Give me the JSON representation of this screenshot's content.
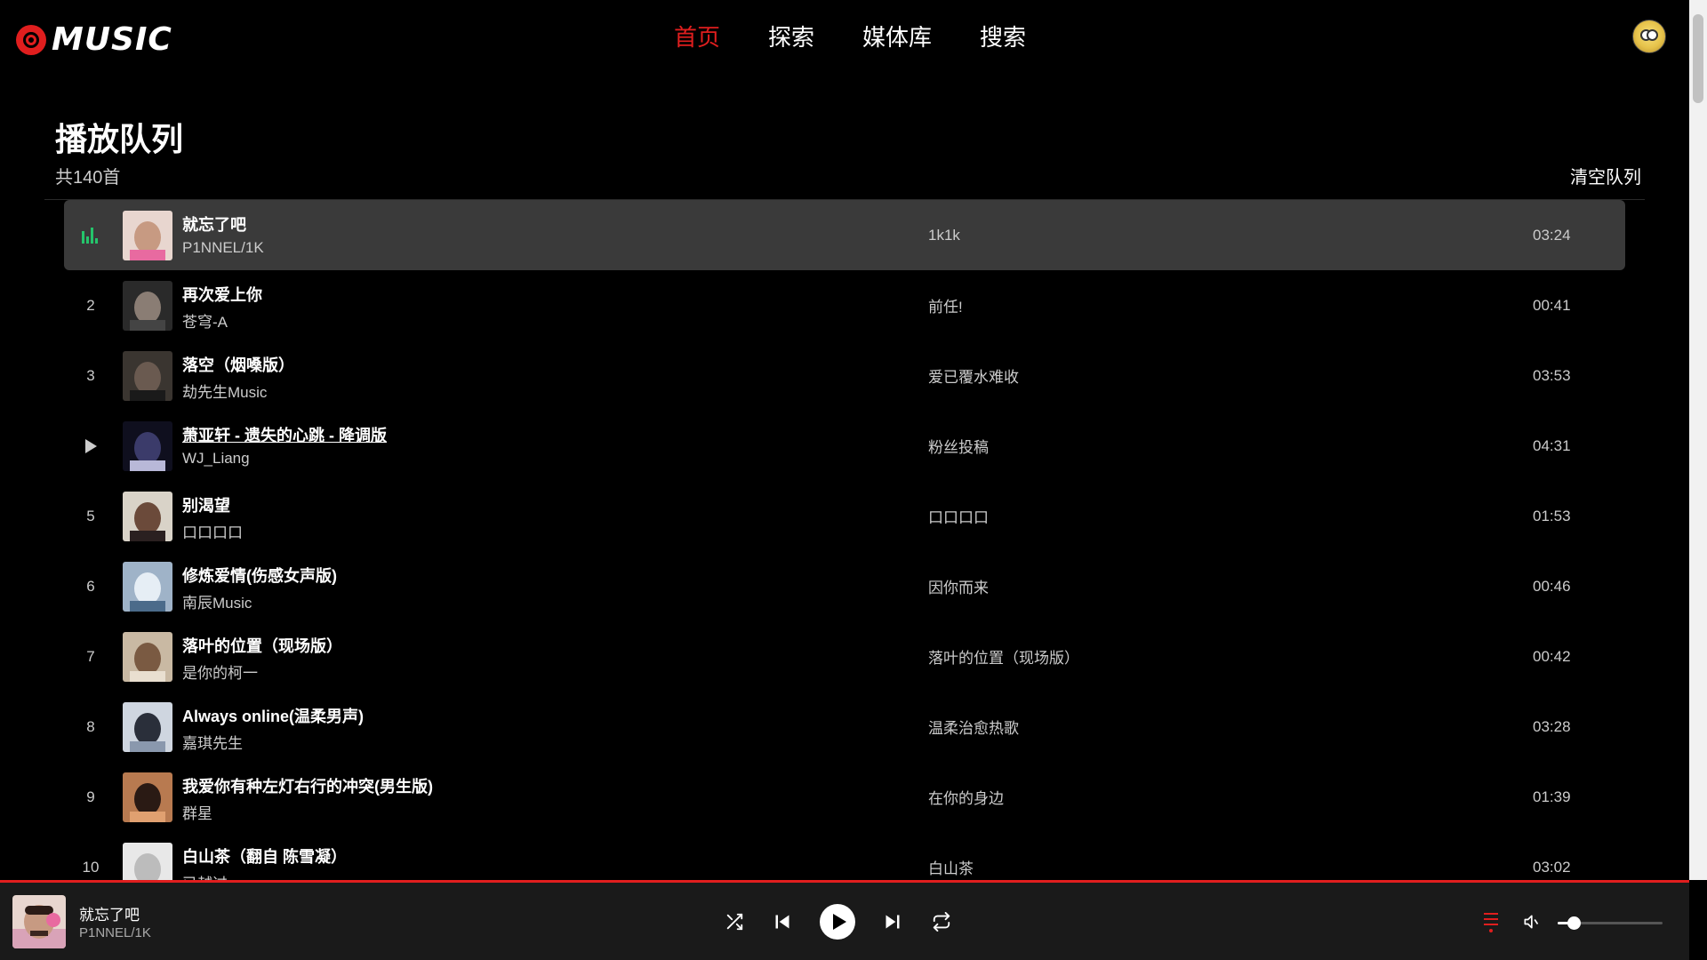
{
  "app": {
    "logo_text": "MUSIC"
  },
  "nav": [
    {
      "label": "首页",
      "active": true
    },
    {
      "label": "探索",
      "active": false
    },
    {
      "label": "媒体库",
      "active": false
    },
    {
      "label": "搜索",
      "active": false
    }
  ],
  "queue": {
    "title": "播放队列",
    "count": "共140首",
    "clear_label": "清空队列",
    "songs": [
      {
        "index": "1",
        "title": "就忘了吧",
        "artist": "P1NNEL/1K",
        "album": "1k1k",
        "duration": "03:24",
        "state": "playing"
      },
      {
        "index": "2",
        "title": "再次爱上你",
        "artist": "苍穹-A",
        "album": "前任!",
        "duration": "00:41",
        "state": "normal"
      },
      {
        "index": "3",
        "title": "落空（烟嗓版）",
        "artist": "劫先生Music",
        "album": "爱已覆水难收",
        "duration": "03:53",
        "state": "normal"
      },
      {
        "index": "4",
        "title": "萧亚轩 - 遗失的心跳 - 降调版",
        "artist": "WJ_Liang",
        "album": "粉丝投稿",
        "duration": "04:31",
        "state": "hover"
      },
      {
        "index": "5",
        "title": "别渴望",
        "artist": "口口口口",
        "album": "口口口口",
        "duration": "01:53",
        "state": "normal"
      },
      {
        "index": "6",
        "title": "修炼爱情(伤感女声版)",
        "artist": "南辰Music",
        "album": "因你而来",
        "duration": "00:46",
        "state": "normal"
      },
      {
        "index": "7",
        "title": "落叶的位置（现场版）",
        "artist": "是你的柯一",
        "album": "落叶的位置（现场版）",
        "duration": "00:42",
        "state": "normal"
      },
      {
        "index": "8",
        "title": "Always online(温柔男声)",
        "artist": "嘉琪先生",
        "album": "温柔治愈热歌",
        "duration": "03:28",
        "state": "normal"
      },
      {
        "index": "9",
        "title": "我爱你有种左灯右行的冲突(男生版)",
        "artist": "群星",
        "album": "在你的身边",
        "duration": "01:39",
        "state": "normal"
      },
      {
        "index": "10",
        "title": "白山茶（翻自 陈雪凝）",
        "artist": "已越过",
        "album": "白山茶",
        "duration": "03:02",
        "state": "normal"
      }
    ]
  },
  "player": {
    "title": "就忘了吧",
    "artist": "P1NNEL/1K",
    "volume": 0.15,
    "icons": [
      "shuffle-icon",
      "previous-icon",
      "play-icon",
      "next-icon",
      "repeat-icon",
      "playlist-icon",
      "volume-icon"
    ]
  },
  "colors": {
    "accent": "#e01e1e",
    "playing_indicator": "#24c46b",
    "active_row": "#3a3a3a",
    "player_bg": "#1a1a1a"
  }
}
